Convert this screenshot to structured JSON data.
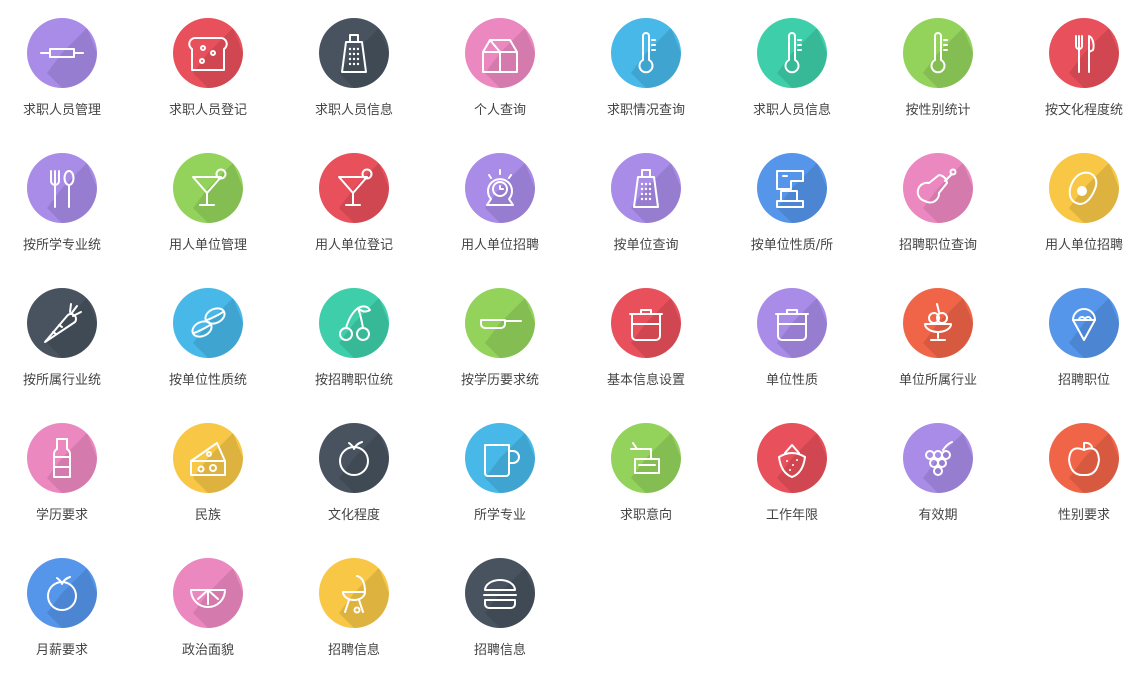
{
  "colors": {
    "purple": "#a98ce8",
    "red": "#e8505b",
    "dark": "#48535f",
    "pink": "#ec88c0",
    "blue": "#47b8e8",
    "teal": "#3ecfaa",
    "green": "#93d35c",
    "yellow": "#f8c746",
    "orange": "#f06548",
    "royal": "#5596ea"
  },
  "tiles": [
    {
      "label": "求职人员管理",
      "color": "purple",
      "icon": "rolling-pin"
    },
    {
      "label": "求职人员登记",
      "color": "red",
      "icon": "bread"
    },
    {
      "label": "求职人员信息",
      "color": "dark",
      "icon": "grater"
    },
    {
      "label": "个人查询",
      "color": "pink",
      "icon": "milk-carton"
    },
    {
      "label": "求职情况查询",
      "color": "blue",
      "icon": "thermometer"
    },
    {
      "label": "求职人员信息",
      "color": "teal",
      "icon": "thermometer"
    },
    {
      "label": "按性别统计",
      "color": "green",
      "icon": "thermometer"
    },
    {
      "label": "按文化程度统",
      "color": "red",
      "icon": "fork-knife"
    },
    {
      "label": "按所学专业统",
      "color": "purple",
      "icon": "fork-spoon"
    },
    {
      "label": "用人单位管理",
      "color": "green",
      "icon": "cocktail"
    },
    {
      "label": "用人单位登记",
      "color": "red",
      "icon": "cocktail"
    },
    {
      "label": "用人单位招聘",
      "color": "purple",
      "icon": "timer"
    },
    {
      "label": "按单位查询",
      "color": "purple",
      "icon": "grater"
    },
    {
      "label": "按单位性质/所",
      "color": "royal",
      "icon": "mixer"
    },
    {
      "label": "招聘职位查询",
      "color": "pink",
      "icon": "drumstick"
    },
    {
      "label": "用人单位招聘",
      "color": "yellow",
      "icon": "avocado"
    },
    {
      "label": "按所属行业统",
      "color": "dark",
      "icon": "carrot"
    },
    {
      "label": "按单位性质统",
      "color": "blue",
      "icon": "coffee-beans"
    },
    {
      "label": "按招聘职位统",
      "color": "teal",
      "icon": "cherry"
    },
    {
      "label": "按学历要求统",
      "color": "green",
      "icon": "frying-pan"
    },
    {
      "label": "基本信息设置",
      "color": "red",
      "icon": "pot"
    },
    {
      "label": "单位性质",
      "color": "purple",
      "icon": "pot"
    },
    {
      "label": "单位所属行业",
      "color": "orange",
      "icon": "sundae"
    },
    {
      "label": "招聘职位",
      "color": "royal",
      "icon": "ice-cream"
    },
    {
      "label": "学历要求",
      "color": "pink",
      "icon": "bottle"
    },
    {
      "label": "民族",
      "color": "yellow",
      "icon": "cheese"
    },
    {
      "label": "文化程度",
      "color": "dark",
      "icon": "orange-fruit"
    },
    {
      "label": "所学专业",
      "color": "blue",
      "icon": "mug"
    },
    {
      "label": "求职意向",
      "color": "green",
      "icon": "fryer"
    },
    {
      "label": "工作年限",
      "color": "red",
      "icon": "strawberry"
    },
    {
      "label": "有效期",
      "color": "purple",
      "icon": "grapes"
    },
    {
      "label": "性别要求",
      "color": "orange",
      "icon": "apple"
    },
    {
      "label": "月薪要求",
      "color": "royal",
      "icon": "orange-fruit"
    },
    {
      "label": "政治面貌",
      "color": "pink",
      "icon": "lemon-slice"
    },
    {
      "label": "招聘信息",
      "color": "yellow",
      "icon": "grill"
    },
    {
      "label": "招聘信息",
      "color": "dark",
      "icon": "burger"
    }
  ]
}
